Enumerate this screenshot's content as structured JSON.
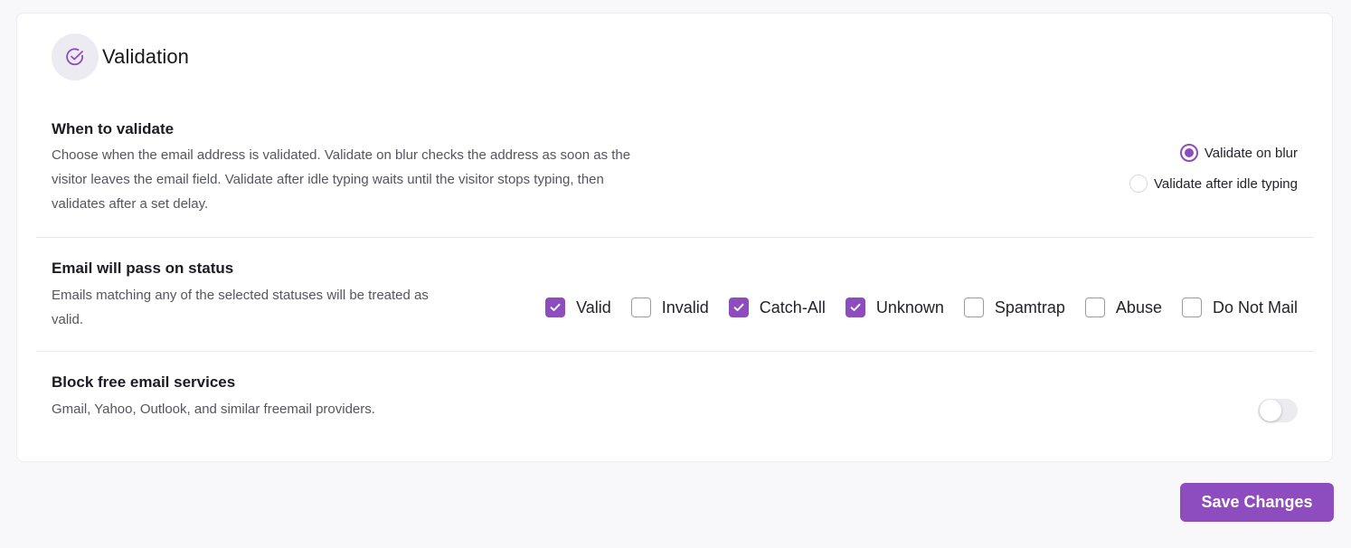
{
  "card": {
    "title": "Validation",
    "icon": "check-circle-icon"
  },
  "when_to_validate": {
    "title": "When to validate",
    "description_lines": [
      "Choose when the email address is validated. Validate on blur checks the address as soon as the",
      "visitor leaves the email field. Validate after idle typing waits until the visitor stops typing, then",
      "validates after a set delay."
    ],
    "options": [
      {
        "label": "Validate on blur",
        "selected": true
      },
      {
        "label": "Validate after idle typing",
        "selected": false
      }
    ]
  },
  "pass_status": {
    "title": "Email will pass on status",
    "description_lines": [
      "Emails matching any of the selected statuses will be treated as",
      "valid."
    ],
    "statuses": [
      {
        "label": "Valid",
        "checked": true
      },
      {
        "label": "Invalid",
        "checked": false
      },
      {
        "label": "Catch-All",
        "checked": true
      },
      {
        "label": "Unknown",
        "checked": true
      },
      {
        "label": "Spamtrap",
        "checked": false
      },
      {
        "label": "Abuse",
        "checked": false
      },
      {
        "label": "Do Not Mail",
        "checked": false
      }
    ]
  },
  "block_free": {
    "title": "Block free email services",
    "description": "Gmail, Yahoo, Outlook, and similar freemail providers.",
    "enabled": false
  },
  "actions": {
    "save_label": "Save Changes"
  },
  "colors": {
    "accent": "#8e4dbf",
    "background": "#f8f8fb",
    "card": "#ffffff"
  }
}
